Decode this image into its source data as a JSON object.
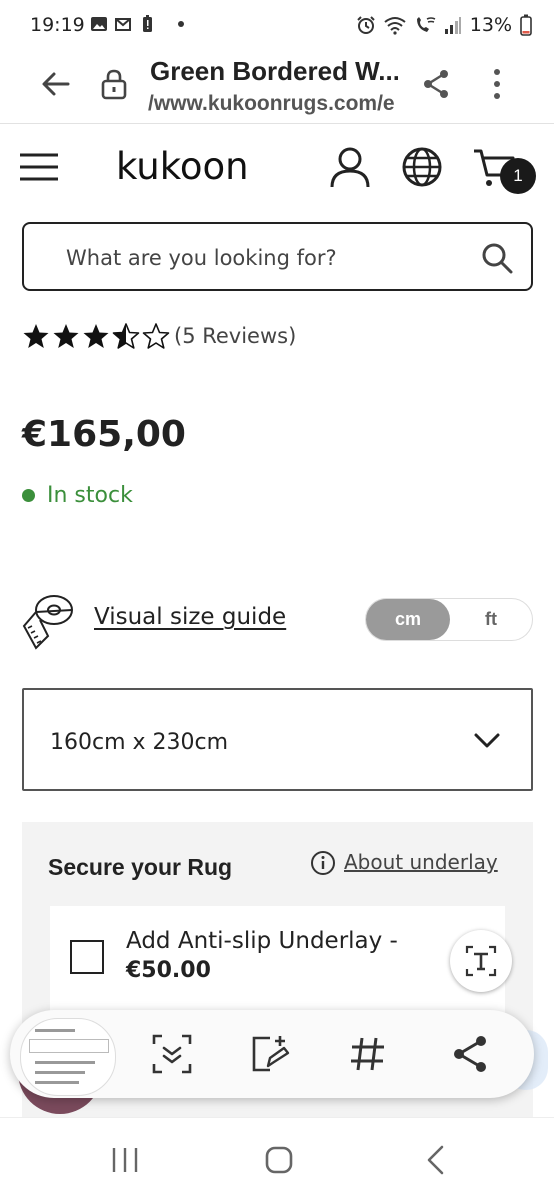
{
  "status_bar": {
    "time": "19:19",
    "battery": "13%"
  },
  "browser": {
    "tab_title": "Green Bordered W...",
    "url": "/www.kukoonrugs.com/e"
  },
  "header": {
    "logo": "kukoon",
    "cart_count": "1"
  },
  "search": {
    "placeholder": "What are you looking for?"
  },
  "product": {
    "rating": 3.5,
    "rating_max": 5,
    "reviews_label": "(5 Reviews)",
    "price": "€165,00",
    "stock_label": "In stock",
    "stock_color": "#3b8f3b"
  },
  "size_guide": {
    "link_label": "Visual size guide",
    "units": [
      "cm",
      "ft"
    ],
    "selected_unit": "cm"
  },
  "size_select": {
    "value": "160cm x 230cm"
  },
  "secure": {
    "title": "Secure your Rug",
    "about_label": "About underlay",
    "underlay_label": "Add Anti-slip Underlay -",
    "underlay_price": "€50.00"
  }
}
